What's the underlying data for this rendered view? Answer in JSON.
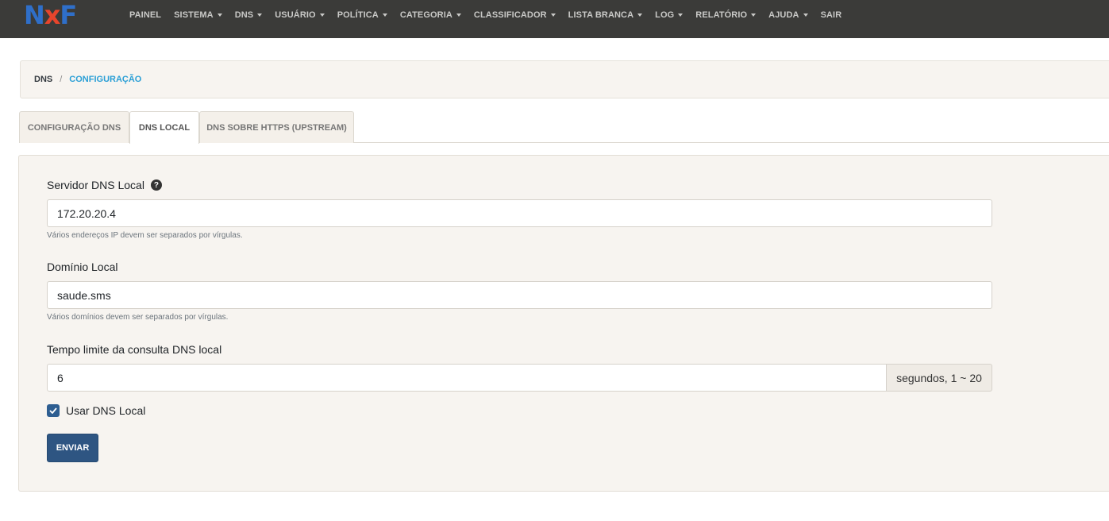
{
  "brand": {
    "letters": [
      "N",
      "x",
      "F"
    ]
  },
  "nav": {
    "items": [
      {
        "label": "PAINEL",
        "dropdown": false
      },
      {
        "label": "SISTEMA",
        "dropdown": true
      },
      {
        "label": "DNS",
        "dropdown": true
      },
      {
        "label": "USUÁRIO",
        "dropdown": true
      },
      {
        "label": "POLÍTICA",
        "dropdown": true
      },
      {
        "label": "CATEGORIA",
        "dropdown": true
      },
      {
        "label": "CLASSIFICADOR",
        "dropdown": true
      },
      {
        "label": "LISTA BRANCA",
        "dropdown": true
      },
      {
        "label": "LOG",
        "dropdown": true
      },
      {
        "label": "RELATÓRIO",
        "dropdown": true
      },
      {
        "label": "AJUDA",
        "dropdown": true
      },
      {
        "label": "SAIR",
        "dropdown": false
      }
    ]
  },
  "breadcrumb": {
    "root": "DNS",
    "separator": "/",
    "current": "CONFIGURAÇÃO"
  },
  "tabs": [
    {
      "label": "CONFIGURAÇÃO DNS",
      "active": false
    },
    {
      "label": "DNS LOCAL",
      "active": true
    },
    {
      "label": "DNS SOBRE HTTPS (UPSTREAM)",
      "active": false
    }
  ],
  "form": {
    "server": {
      "label": "Servidor DNS Local",
      "value": "172.20.20.4",
      "help": "Vários endereços IP devem ser separados por vírgulas.",
      "help_icon": "?"
    },
    "domain": {
      "label": "Domínio Local",
      "value": "saude.sms",
      "help": "Vários domínios devem ser separados por vírgulas."
    },
    "timeout": {
      "label": "Tempo limite da consulta DNS local",
      "value": "6",
      "addon": "segundos, 1 ~ 20"
    },
    "use_local": {
      "label": "Usar DNS Local",
      "checked": true
    },
    "submit_label": "ENVIAR"
  },
  "colors": {
    "navbar": "#3b3b39",
    "accent": "#2a9fd6",
    "primary": "#2e5582",
    "panel": "#f7f4f0"
  }
}
